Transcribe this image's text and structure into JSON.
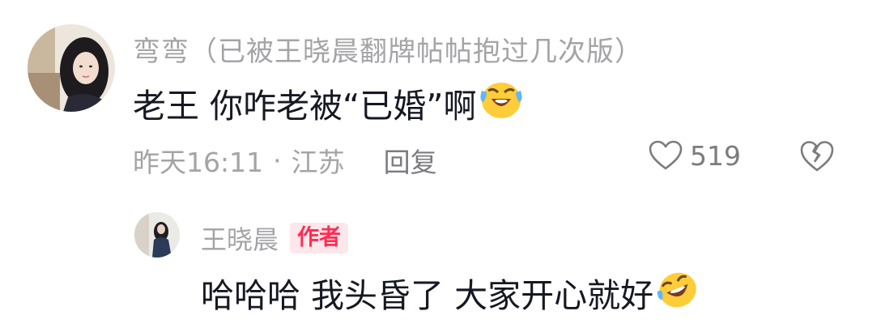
{
  "comment": {
    "username": "弯弯（已被王晓晨翻牌帖帖抱过几次版）",
    "text": "老王 你咋老被“已婚”啊",
    "emoji": "crying-laughing",
    "time": "昨天16:11",
    "dot": "·",
    "location": "江苏",
    "reply_label": "回复",
    "like_count": "519"
  },
  "reply": {
    "username": "王晓晨",
    "badge": "作者",
    "text": "哈哈哈 我头昏了 大家开心就好",
    "emoji": "rolling-laughing"
  },
  "colors": {
    "text_primary": "#161823",
    "text_secondary": "#a4a4a8",
    "badge_bg": "#fde7ea",
    "badge_fg": "#fe2c55"
  }
}
